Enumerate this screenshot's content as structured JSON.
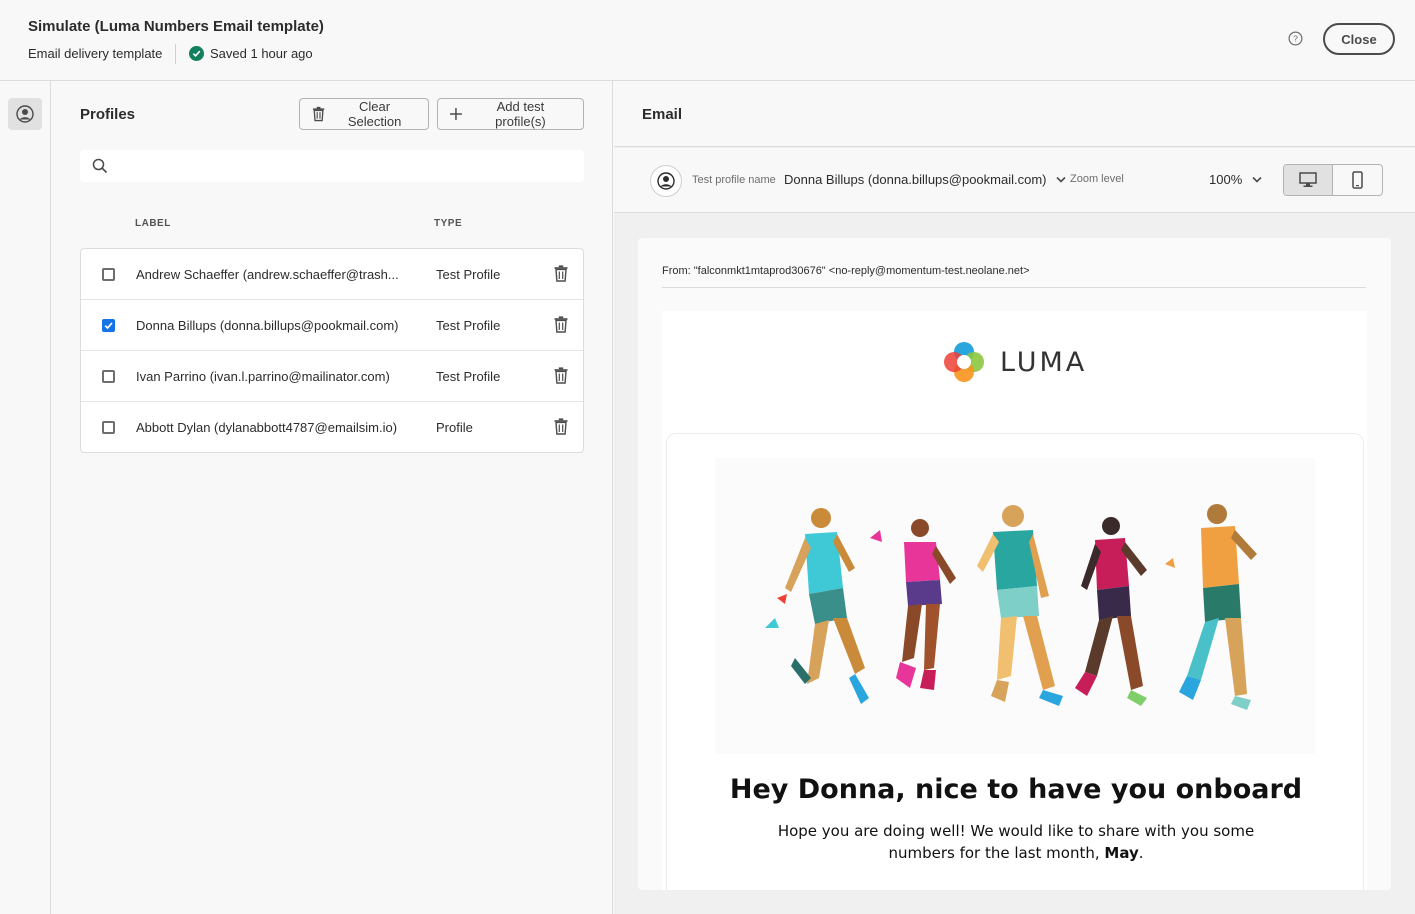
{
  "header": {
    "title": "Simulate (Luma Numbers Email template)",
    "subtitle": "Email delivery template",
    "status": "Saved 1 hour ago",
    "close_label": "Close"
  },
  "profiles": {
    "title": "Profiles",
    "clear_label": "Clear Selection",
    "add_label": "Add test profile(s)",
    "search_placeholder": "",
    "columns": {
      "label": "LABEL",
      "type": "TYPE"
    },
    "rows": [
      {
        "label": "Andrew Schaeffer (andrew.schaeffer@trash...",
        "type": "Test Profile",
        "checked": false
      },
      {
        "label": "Donna Billups (donna.billups@pookmail.com)",
        "type": "Test Profile",
        "checked": true
      },
      {
        "label": "Ivan Parrino (ivan.l.parrino@mailinator.com)",
        "type": "Test Profile",
        "checked": false
      },
      {
        "label": "Abbott Dylan (dylanabbott4787@emailsim.io)",
        "type": "Profile",
        "checked": false
      }
    ]
  },
  "email": {
    "title": "Email",
    "test_profile_label": "Test profile name",
    "test_profile_value": "Donna Billups (donna.billups@pookmail.com)",
    "zoom_label": "Zoom level",
    "zoom_value": "100%",
    "from": "From: \"falconmkt1mtaprod30676\" <no-reply@momentum-test.neolane.net>",
    "logo_text": "LUMA",
    "headline": "Hey Donna, nice to have you onboard",
    "body_text_1": "Hope you are doing well! We would like to share with you some numbers for the last month, ",
    "body_text_bold": "May",
    "body_text_2": "."
  },
  "colors": {
    "accent": "#1473e6",
    "success": "#12805c"
  }
}
